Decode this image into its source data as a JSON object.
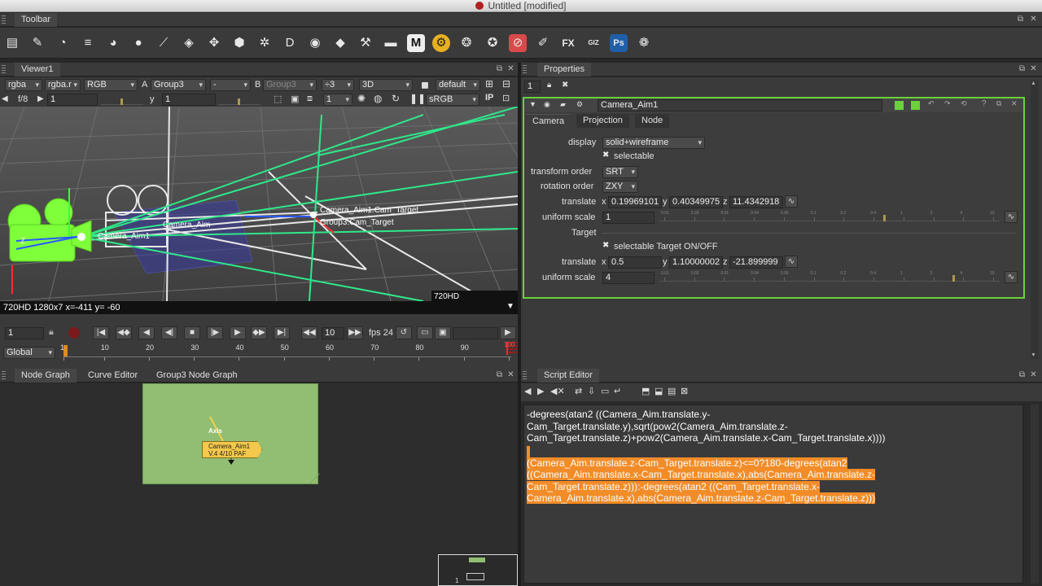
{
  "window": {
    "title": "Untitled [modified]"
  },
  "toolbar": {
    "tab": "Toolbar",
    "tools": [
      {
        "name": "image-icon",
        "glyph": "▤"
      },
      {
        "name": "draw-icon",
        "glyph": "✎"
      },
      {
        "name": "time-icon",
        "glyph": "◔"
      },
      {
        "name": "channel-icon",
        "glyph": "≡"
      },
      {
        "name": "color-icon",
        "glyph": "◕"
      },
      {
        "name": "filter-icon",
        "glyph": "●"
      },
      {
        "name": "keyer-icon",
        "glyph": "⟋"
      },
      {
        "name": "merge-icon",
        "glyph": "◈"
      },
      {
        "name": "transform-icon",
        "glyph": "✥"
      },
      {
        "name": "3d-icon",
        "glyph": "⬢"
      },
      {
        "name": "particles-icon",
        "glyph": "✲"
      },
      {
        "name": "deep-icon",
        "glyph": "D"
      },
      {
        "name": "views-icon",
        "glyph": "◉"
      },
      {
        "name": "metadata-icon",
        "glyph": "◆"
      },
      {
        "name": "toolsets-icon",
        "glyph": "⚒"
      },
      {
        "name": "other-icon",
        "glyph": "▬"
      },
      {
        "name": "m-icon",
        "glyph": "M"
      },
      {
        "name": "furnace-icon",
        "glyph": "⚙"
      },
      {
        "name": "bokeh-icon",
        "glyph": "❂"
      },
      {
        "name": "globe-icon",
        "glyph": "✪"
      },
      {
        "name": "disable-icon",
        "glyph": "⊘"
      },
      {
        "name": "brush-icon",
        "glyph": "✐"
      },
      {
        "name": "fx-icon",
        "glyph": "FX"
      },
      {
        "name": "giz-icon",
        "glyph": "GIZ"
      },
      {
        "name": "ps-icon",
        "glyph": "Ps"
      },
      {
        "name": "gear-icon",
        "glyph": "❁"
      }
    ]
  },
  "viewer": {
    "tab": "Viewer1",
    "channels": "rgba",
    "layer": "rgba.r",
    "display_mode": "RGB",
    "a_label": "A",
    "input_a": "Group3",
    "ab_mode": "-",
    "b_label": "B",
    "input_b": "Group3",
    "proxy": "÷3",
    "view_mode": "3D",
    "camera": "default",
    "fstop": "f/8",
    "gain": "1",
    "gamma_label": "y",
    "gamma": "1",
    "frame_count": "1",
    "colorspace": "sRGB",
    "status": "720HD 1280x7  x=-411 y= -60",
    "format_label": "720HD",
    "labels": {
      "cam_target": "Camera_Aim1.Cam_Target",
      "group_target": "Group3.Cam_Target",
      "camera_aim": "Camera_Aim",
      "camera_aim2": "Camera_Aim1",
      "neg_z": "Z"
    }
  },
  "timeline": {
    "frame": "1",
    "increment": "10",
    "fps": "fps 24",
    "range_mode": "Global",
    "ticks": [
      "1",
      "10",
      "20",
      "30",
      "40",
      "50",
      "60",
      "70",
      "80",
      "90",
      "100"
    ],
    "end_frame": "100"
  },
  "node_graph": {
    "tabs": [
      "Node Graph",
      "Curve Editor",
      "Group3 Node Graph"
    ],
    "axis_label": "Axis",
    "node_title": "Camera_Aim1",
    "node_sub": "V.4 4/10 PAF",
    "minimap_num": "1"
  },
  "properties": {
    "tab": "Properties",
    "max_panels": "1",
    "node_name": "Camera_Aim1",
    "subtabs": [
      "Camera",
      "Projection",
      "Node"
    ],
    "rows": {
      "display_label": "display",
      "display_value": "solid+wireframe",
      "selectable_label": "selectable",
      "transform_order_label": "transform order",
      "transform_order_value": "SRT",
      "rotation_order_label": "rotation order",
      "rotation_order_value": "ZXY",
      "translate_label": "translate",
      "translate_x": "0.19969101",
      "translate_y": "0.40349975",
      "translate_z": "11.4342918",
      "uniform_scale_label": "uniform scale",
      "uniform_scale_value": "1",
      "target_label": "Target",
      "selectable_target_label": "selectable Target ON/OFF",
      "target_translate_label": "translate",
      "target_x": "0.5",
      "target_y": "1.10000002",
      "target_z": "-21.899999",
      "target_scale_label": "uniform scale",
      "target_scale_value": "4"
    },
    "axis_x": "x",
    "axis_y": "y",
    "axis_z": "z",
    "slider_scale1": [
      "0.01",
      "0.03",
      "0.01",
      "0.04",
      "0.06",
      "0.1",
      "0.2",
      "0.4",
      "1",
      "2",
      "4",
      "10"
    ],
    "slider_scale2": [
      "0.01",
      "0.03",
      "0.01",
      "0.04",
      "0.06",
      "0.1",
      "0.2",
      "0.4",
      "1",
      "2",
      "4",
      "10"
    ]
  },
  "script_editor": {
    "tab": "Script Editor",
    "code_normal": "-degrees(atan2 ((Camera_Aim.translate.y-\nCam_Target.translate.y),sqrt(pow2(Camera_Aim.translate.z-\nCam_Target.translate.z)+pow2(Camera_Aim.translate.x-Cam_Target.translate.x))))",
    "code_highlighted": "(Camera_Aim.translate.z-Cam_Target.translate.z)<=0?180-degrees(atan2\n((Camera_Aim.translate.x-Cam_Target.translate.x),abs(Camera_Aim.translate.z-\nCam_Target.translate.z))):-degrees(atan2 ((Cam_Target.translate.x-\nCamera_Aim.translate.x),abs(Camera_Aim.translate.z-Cam_Target.translate.z)))",
    "highlight_color": "#f28c28"
  }
}
